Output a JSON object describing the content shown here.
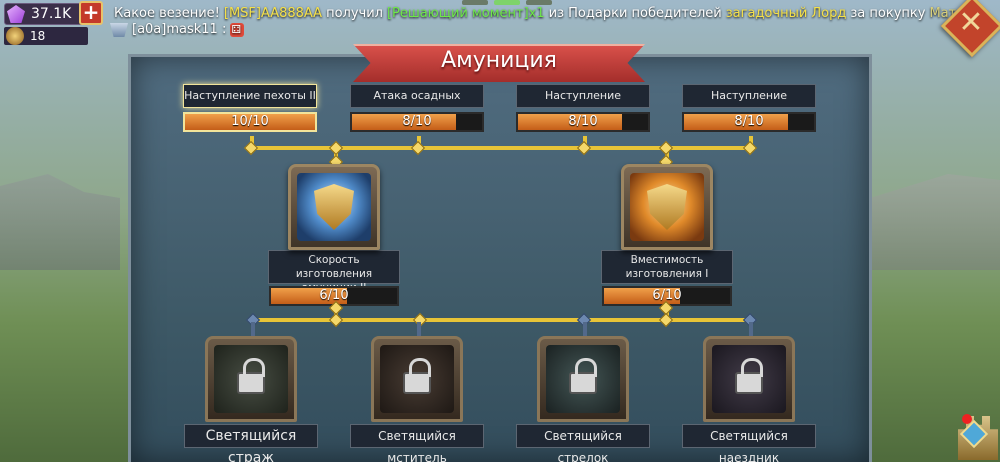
{
  "header": {
    "gems": "37.1K",
    "plus_label": "+",
    "badge_value": "18",
    "close_icon": "close-icon"
  },
  "chat": {
    "line1": {
      "prefix": "Какое везение!",
      "player": "[MSF]AA888AA",
      "verb": "получил",
      "item": "[Решающий момент]x1",
      "from": "из Подарки победителей",
      "lord": "загадочный Лорд",
      "purchase": "за покупку",
      "tail": "Матер···"
    },
    "line2": "[a0a]mask11 :"
  },
  "panel": {
    "title": "Амуниция"
  },
  "tier1": [
    {
      "name": "Наступление пехоты II",
      "progress": "10/10",
      "fill": 1.0,
      "selected": true
    },
    {
      "name": "Атака осадных орудий II",
      "progress": "8/10",
      "fill": 0.8,
      "selected": false
    },
    {
      "name": "Наступление стрелков II",
      "progress": "8/10",
      "fill": 0.8,
      "selected": false
    },
    {
      "name": "Наступление кавалерии II",
      "progress": "8/10",
      "fill": 0.8,
      "selected": false
    }
  ],
  "tier2": [
    {
      "name": "Скорость изготовления амуниции II",
      "progress": "6/10",
      "fill": 0.6
    },
    {
      "name": "Вместимость изготовления I",
      "progress": "6/10",
      "fill": 0.6
    }
  ],
  "tier3": [
    {
      "name": "Светящийся страж"
    },
    {
      "name": "Светящийся мститель"
    },
    {
      "name": "Светящийся стрелок"
    },
    {
      "name": "Светящийся наездник"
    }
  ],
  "colors": {
    "accent_orange": "#e07a28",
    "connector_gold": "#e8c437",
    "title_red": "#c23a32"
  }
}
